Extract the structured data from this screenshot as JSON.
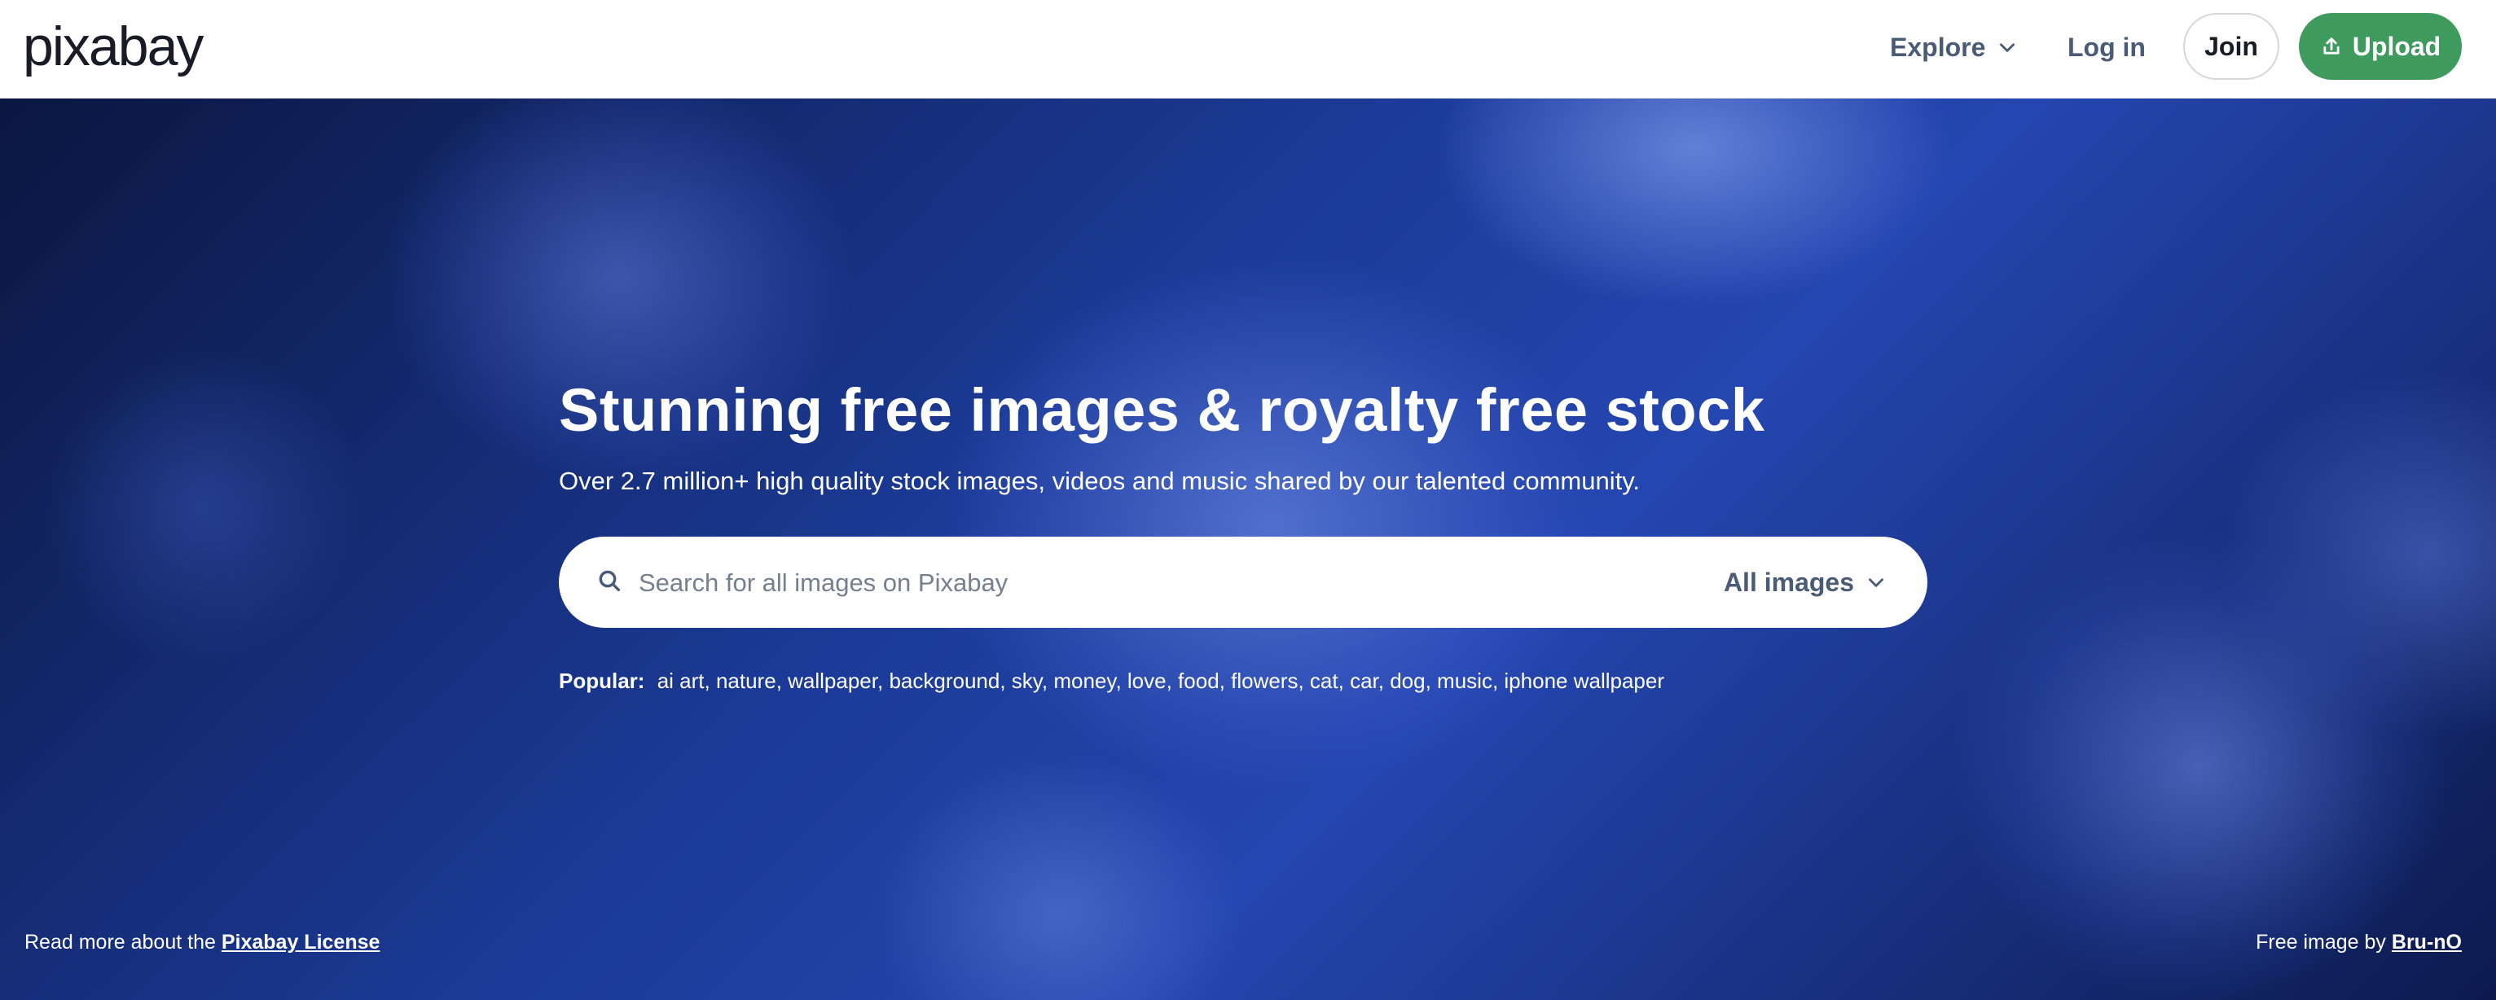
{
  "header": {
    "logo_text": "pixabay",
    "explore_label": "Explore",
    "login_label": "Log in",
    "join_label": "Join",
    "upload_label": "Upload"
  },
  "hero": {
    "title": "Stunning free images & royalty free stock",
    "subtitle": "Over 2.7 million+ high quality stock images, videos and music shared by our talented community.",
    "search": {
      "placeholder": "Search for all images on Pixabay",
      "value": "",
      "type_selected": "All images"
    },
    "popular": {
      "label": "Popular:",
      "tags": [
        "ai art",
        "nature",
        "wallpaper",
        "background",
        "sky",
        "money",
        "love",
        "food",
        "flowers",
        "cat",
        "car",
        "dog",
        "music",
        "iphone wallpaper"
      ]
    }
  },
  "footer_notes": {
    "license_prefix": "Read more about the",
    "license_link": "Pixabay License",
    "credit_prefix": "Free image by",
    "credit_link": "Bru-nO"
  },
  "colors": {
    "upload_green": "#3f9a5e",
    "nav_text": "#4a5b75",
    "hero_blue": "#1b3a96"
  },
  "icons": {
    "explore_chevron": "chevron-down-icon",
    "upload": "upload-icon",
    "search": "search-icon",
    "select_chevron": "chevron-down-icon"
  }
}
